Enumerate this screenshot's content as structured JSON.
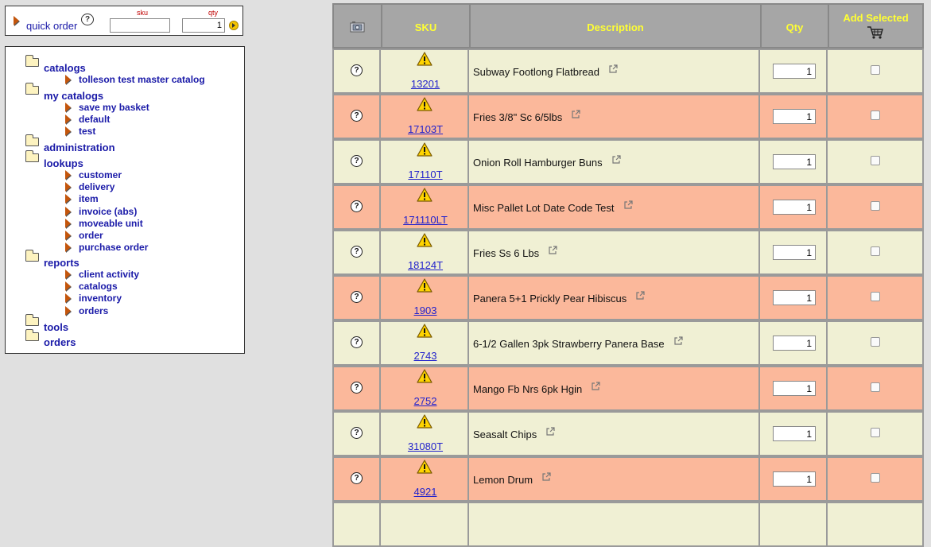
{
  "quick_order": {
    "label": "quick order",
    "help_symbol": "?",
    "sku_caption": "sku",
    "qty_caption": "qty",
    "sku_value": "",
    "qty_value": "1"
  },
  "nav": {
    "sections": [
      {
        "label": "catalogs",
        "items": [
          "tolleson test master catalog"
        ]
      },
      {
        "label": "my catalogs",
        "items": [
          "save my basket",
          "default",
          "test"
        ]
      },
      {
        "label": "administration",
        "items": []
      },
      {
        "label": "lookups",
        "items": [
          "customer",
          "delivery",
          "item",
          "invoice (abs)",
          "moveable unit",
          "order",
          "purchase order"
        ]
      },
      {
        "label": "reports",
        "items": [
          "client activity",
          "catalogs",
          "inventory",
          "orders"
        ]
      },
      {
        "label": "tools",
        "items": []
      },
      {
        "label": "orders",
        "items": []
      }
    ]
  },
  "table": {
    "headers": {
      "sku": "SKU",
      "description": "Description",
      "qty": "Qty",
      "add_selected": "Add Selected"
    },
    "colors": {
      "header_text": "#ffff33",
      "row_even": "#f0f0d4",
      "row_odd": "#fbb89b"
    },
    "rows": [
      {
        "sku": "13201",
        "description": "Subway Footlong Flatbread",
        "qty": "1"
      },
      {
        "sku": "17103T",
        "description": "Fries 3/8\" Sc 6/5lbs",
        "qty": "1"
      },
      {
        "sku": "17110T",
        "description": "Onion Roll Hamburger Buns",
        "qty": "1"
      },
      {
        "sku": "171110LT",
        "description": "Misc Pallet Lot Date Code Test",
        "qty": "1"
      },
      {
        "sku": "18124T",
        "description": "Fries Ss 6 Lbs",
        "qty": "1"
      },
      {
        "sku": "1903",
        "description": "Panera 5+1 Prickly Pear Hibiscus",
        "qty": "1"
      },
      {
        "sku": "2743",
        "description": "6-1/2 Gallen 3pk Strawberry Panera Base",
        "qty": "1"
      },
      {
        "sku": "2752",
        "description": "Mango Fb Nrs 6pk Hgin",
        "qty": "1"
      },
      {
        "sku": "31080T",
        "description": "Seasalt Chips",
        "qty": "1"
      },
      {
        "sku": "4921",
        "description": "Lemon Drum",
        "qty": "1"
      }
    ]
  }
}
